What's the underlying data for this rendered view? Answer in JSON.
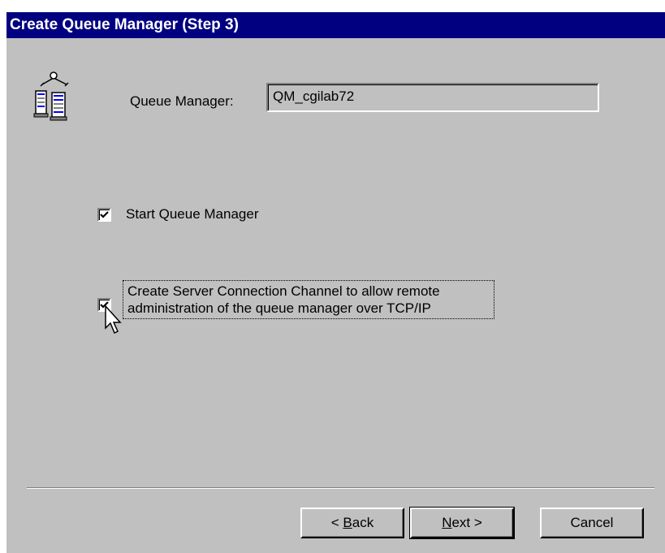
{
  "window": {
    "title": "Create Queue Manager (Step 3)"
  },
  "queue_manager": {
    "label": "Queue Manager:",
    "value": "QM_cgilab72"
  },
  "options": {
    "start_label": "Start Queue Manager",
    "start_checked": true,
    "channel_label_line1": "Create Server Connection Channel to allow remote",
    "channel_label_line2": "administration of the queue manager over TCP/IP",
    "channel_checked": true
  },
  "buttons": {
    "back_prefix": "< ",
    "back_mnemonic": "B",
    "back_rest": "ack",
    "next_mnemonic": "N",
    "next_rest": "ext >",
    "cancel": "Cancel"
  },
  "icons": {
    "app": "queue-manager-icon",
    "cursor": "mouse-pointer-icon",
    "check": "checkmark-icon"
  },
  "colors": {
    "titlebar": "#000080",
    "face": "#c0c0c0"
  }
}
